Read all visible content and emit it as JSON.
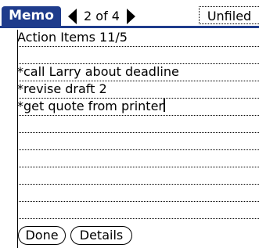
{
  "app": {
    "title": "Memo"
  },
  "header": {
    "page_indicator": "2 of 4",
    "category": "Unfiled",
    "prev_icon": "triangle-left-icon",
    "next_icon": "triangle-right-icon"
  },
  "memo": {
    "lines": [
      "Action Items 11/5",
      "",
      "*call Larry about deadline",
      "*revise draft 2",
      "*get quote from printer",
      "",
      "",
      "",
      "",
      "",
      ""
    ]
  },
  "buttons": {
    "done_label": "Done",
    "details_label": "Details"
  },
  "colors": {
    "title_bar": "#1f3c8c",
    "title_text": "#ffffff",
    "background": "#ffffff",
    "text": "#000000"
  }
}
